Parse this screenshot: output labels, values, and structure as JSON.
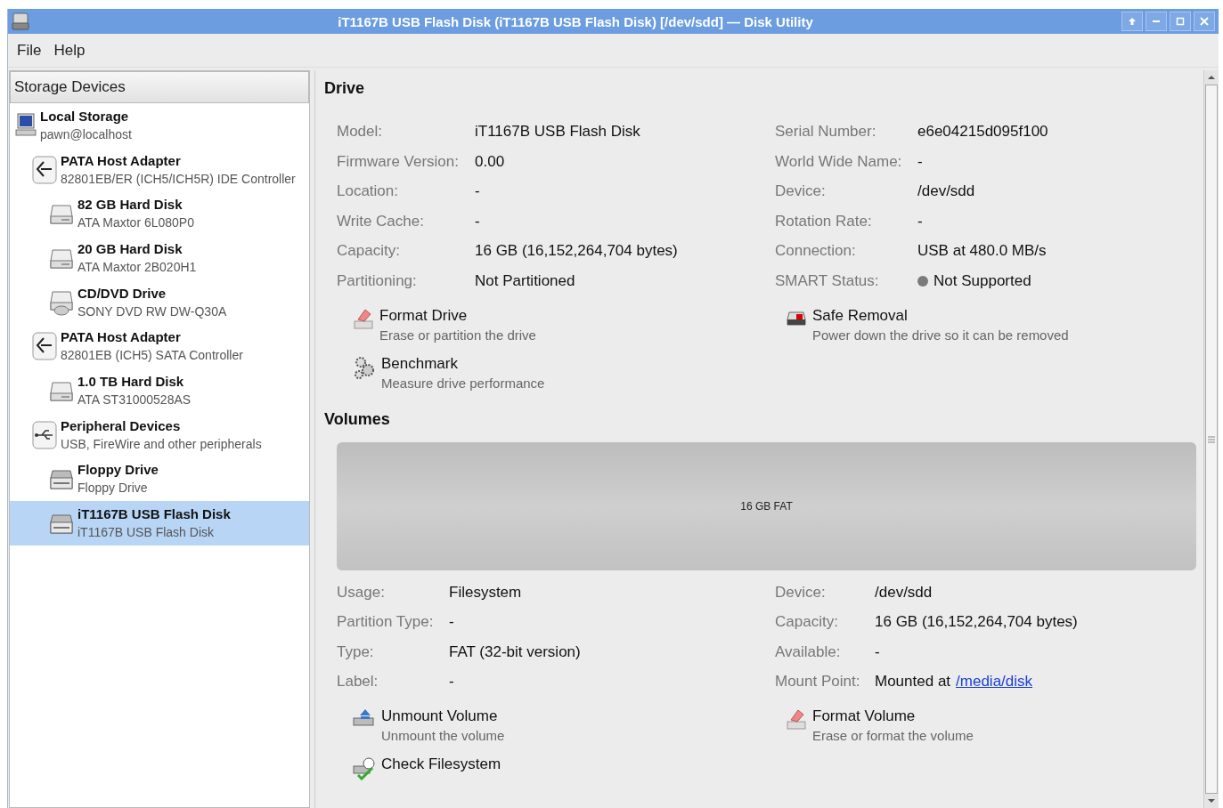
{
  "window": {
    "title": "iT1167B USB Flash Disk (iT1167B USB Flash Disk) [/dev/sdd] — Disk Utility"
  },
  "menu": [
    "File",
    "Help"
  ],
  "sidebar": {
    "header": "Storage Devices",
    "items": [
      {
        "name": "Local Storage",
        "detail": "pawn@localhost",
        "kind": "computer",
        "selected": false,
        "children": [
          {
            "name": "PATA Host Adapter",
            "detail": "82801EB/ER (ICH5/ICH5R) IDE Controller",
            "kind": "adapter",
            "selected": false,
            "children": [
              {
                "name": "82 GB Hard Disk",
                "detail": "ATA Maxtor 6L080P0",
                "kind": "disk",
                "selected": false
              },
              {
                "name": "20 GB Hard Disk",
                "detail": "ATA Maxtor 2B020H1",
                "kind": "disk",
                "selected": false
              },
              {
                "name": "CD/DVD Drive",
                "detail": "SONY DVD RW DW-Q30A",
                "kind": "optical",
                "selected": false
              }
            ]
          },
          {
            "name": "PATA Host Adapter",
            "detail": "82801EB (ICH5) SATA Controller",
            "kind": "adapter",
            "selected": false,
            "children": [
              {
                "name": "1.0 TB Hard Disk",
                "detail": "ATA ST31000528AS",
                "kind": "disk",
                "selected": false
              }
            ]
          },
          {
            "name": "Peripheral Devices",
            "detail": "USB, FireWire and other peripherals",
            "kind": "usb",
            "selected": false,
            "children": [
              {
                "name": "Floppy Drive",
                "detail": "Floppy Drive",
                "kind": "floppy",
                "selected": false
              },
              {
                "name": "iT1167B USB Flash Disk",
                "detail": "iT1167B USB Flash Disk",
                "kind": "floppy",
                "selected": true
              }
            ]
          }
        ]
      }
    ]
  },
  "drive": {
    "title": "Drive",
    "fields": [
      {
        "label": "Model:",
        "value": "iT1167B USB Flash Disk"
      },
      {
        "label": "Serial Number:",
        "value": "e6e04215d095f100"
      },
      {
        "label": "Firmware Version:",
        "value": "0.00"
      },
      {
        "label": "World Wide Name:",
        "value": "-"
      },
      {
        "label": "Location:",
        "value": "-"
      },
      {
        "label": "Device:",
        "value": "/dev/sdd"
      },
      {
        "label": "Write Cache:",
        "value": "-"
      },
      {
        "label": "Rotation Rate:",
        "value": "-"
      },
      {
        "label": "Capacity:",
        "value": "16 GB (16,152,264,704 bytes)"
      },
      {
        "label": "Connection:",
        "value": "USB at 480.0 MB/s"
      },
      {
        "label": "Partitioning:",
        "value": "Not Partitioned"
      },
      {
        "label": "SMART Status:",
        "value": "Not Supported",
        "color": "#7a7a7a"
      }
    ],
    "actions": [
      {
        "title": "Format Drive",
        "description": "Erase or partition the drive",
        "kind": "format"
      },
      {
        "title": "Safe Removal",
        "description": "Power down the drive so it can be removed",
        "kind": "eject"
      },
      {
        "title": "Benchmark",
        "description": "Measure drive performance",
        "kind": "gears"
      }
    ]
  },
  "volumes": {
    "title": "Volumes",
    "partition_label": "16 GB FAT",
    "fields": [
      {
        "label": "Usage:",
        "value": "Filesystem"
      },
      {
        "label": "Device:",
        "value": "/dev/sdd"
      },
      {
        "label": "Partition Type:",
        "value": "-"
      },
      {
        "label": "Capacity:",
        "value": "16 GB (16,152,264,704 bytes)"
      },
      {
        "label": "Type:",
        "value": "FAT (32-bit version)"
      },
      {
        "label": "Available:",
        "value": "-"
      },
      {
        "label": "Label:",
        "value": "-"
      },
      {
        "label": "Mount Point:",
        "value": "Mounted at",
        "link": "/media/disk"
      }
    ],
    "actions": [
      {
        "title": "Unmount Volume",
        "description": "Unmount the volume",
        "kind": "unmount"
      },
      {
        "title": "Format Volume",
        "description": "Erase or format the volume",
        "kind": "format"
      },
      {
        "title": "Check Filesystem",
        "kind": "check"
      }
    ]
  }
}
